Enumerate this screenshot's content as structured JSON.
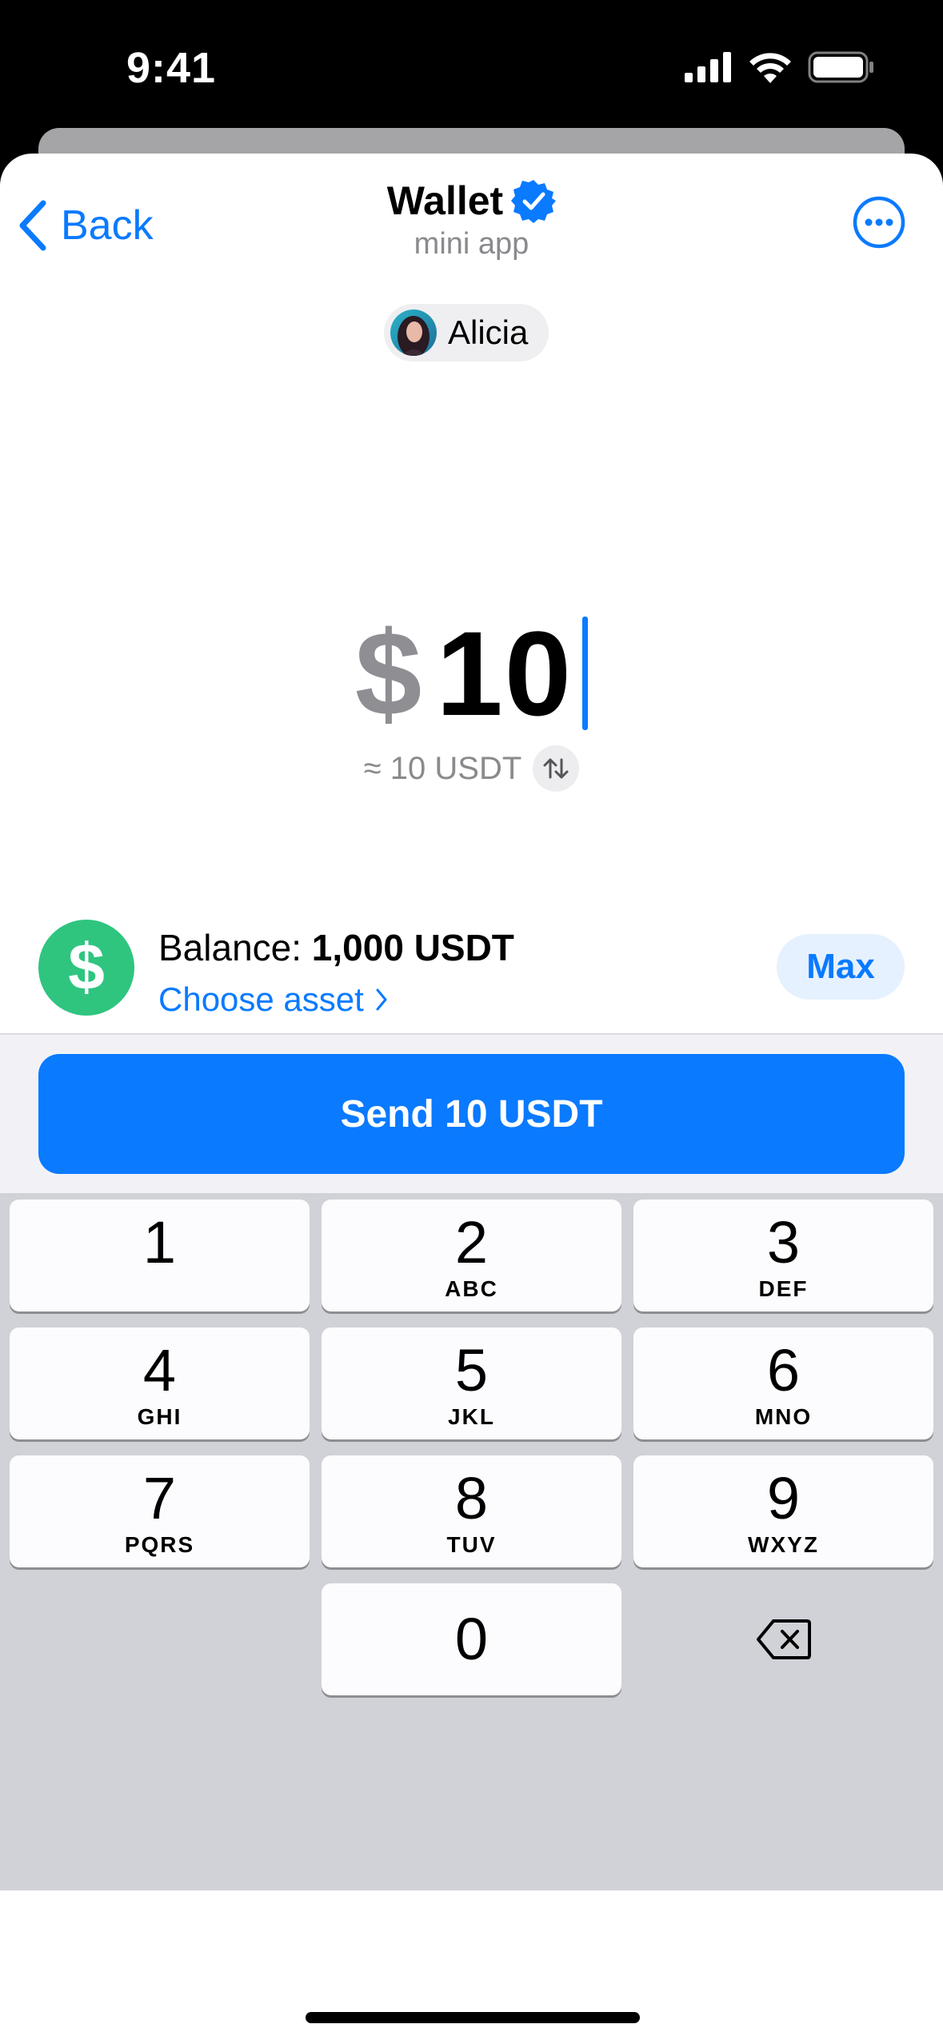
{
  "status_bar": {
    "time": "9:41"
  },
  "header": {
    "back_label": "Back",
    "title": "Wallet",
    "subtitle": "mini app"
  },
  "recipient": {
    "name": "Alicia"
  },
  "amount": {
    "currency_symbol": "$",
    "value": "10",
    "conversion": "≈ 10 USDT"
  },
  "balance": {
    "label": "Balance: ",
    "value": "1,000 USDT",
    "choose_asset": "Choose asset",
    "max_label": "Max"
  },
  "send_button": {
    "label": "Send 10 USDT"
  },
  "keypad": {
    "keys": [
      {
        "digit": "1",
        "letters": ""
      },
      {
        "digit": "2",
        "letters": "ABC"
      },
      {
        "digit": "3",
        "letters": "DEF"
      },
      {
        "digit": "4",
        "letters": "GHI"
      },
      {
        "digit": "5",
        "letters": "JKL"
      },
      {
        "digit": "6",
        "letters": "MNO"
      },
      {
        "digit": "7",
        "letters": "PQRS"
      },
      {
        "digit": "8",
        "letters": "TUV"
      },
      {
        "digit": "9",
        "letters": "WXYZ"
      },
      {
        "digit": "0",
        "letters": ""
      }
    ]
  },
  "colors": {
    "accent": "#0a7aff",
    "asset_green": "#2fc57f",
    "keyboard_bg": "#d1d2d8"
  }
}
